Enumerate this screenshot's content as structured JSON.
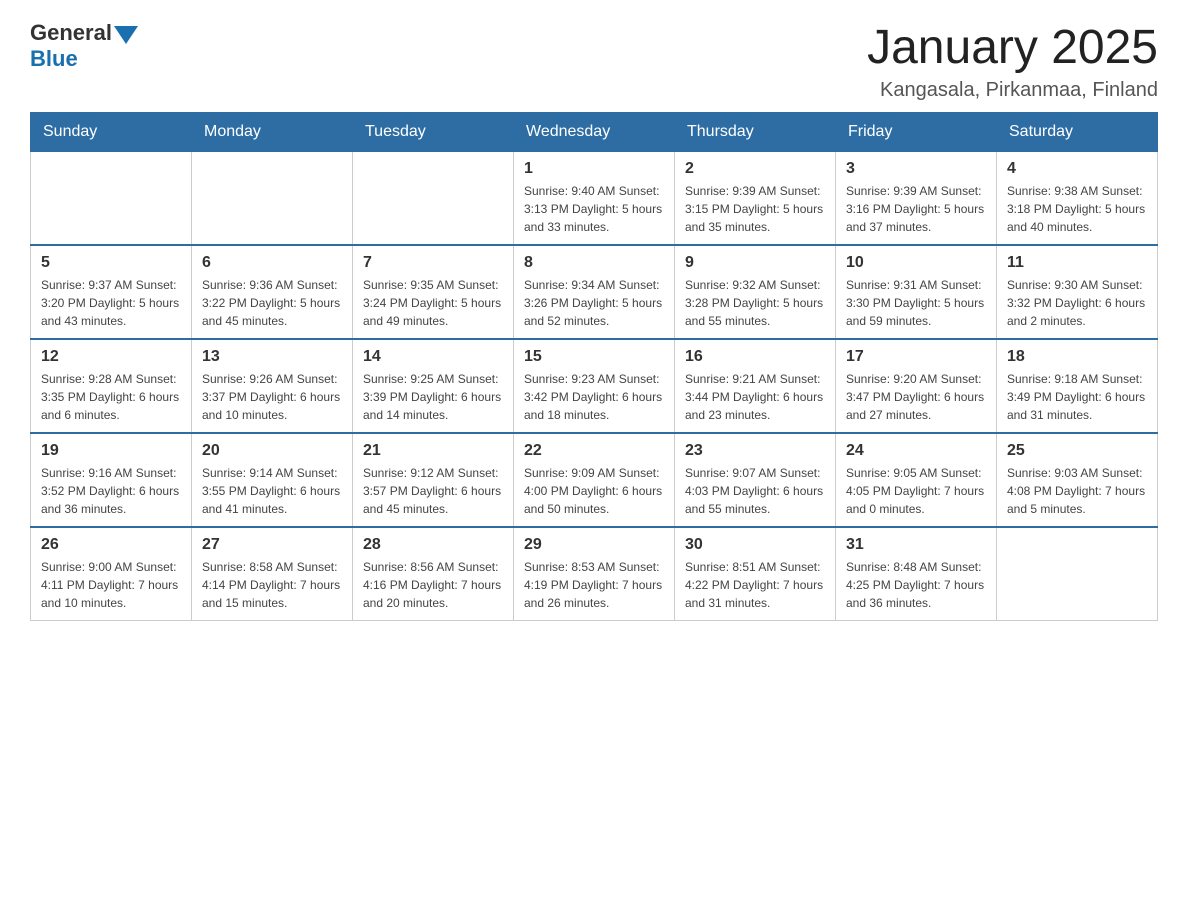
{
  "header": {
    "logo": {
      "general": "General",
      "blue": "Blue"
    },
    "title": "January 2025",
    "subtitle": "Kangasala, Pirkanmaa, Finland"
  },
  "weekdays": [
    "Sunday",
    "Monday",
    "Tuesday",
    "Wednesday",
    "Thursday",
    "Friday",
    "Saturday"
  ],
  "weeks": [
    [
      {
        "day": "",
        "info": ""
      },
      {
        "day": "",
        "info": ""
      },
      {
        "day": "",
        "info": ""
      },
      {
        "day": "1",
        "info": "Sunrise: 9:40 AM\nSunset: 3:13 PM\nDaylight: 5 hours\nand 33 minutes."
      },
      {
        "day": "2",
        "info": "Sunrise: 9:39 AM\nSunset: 3:15 PM\nDaylight: 5 hours\nand 35 minutes."
      },
      {
        "day": "3",
        "info": "Sunrise: 9:39 AM\nSunset: 3:16 PM\nDaylight: 5 hours\nand 37 minutes."
      },
      {
        "day": "4",
        "info": "Sunrise: 9:38 AM\nSunset: 3:18 PM\nDaylight: 5 hours\nand 40 minutes."
      }
    ],
    [
      {
        "day": "5",
        "info": "Sunrise: 9:37 AM\nSunset: 3:20 PM\nDaylight: 5 hours\nand 43 minutes."
      },
      {
        "day": "6",
        "info": "Sunrise: 9:36 AM\nSunset: 3:22 PM\nDaylight: 5 hours\nand 45 minutes."
      },
      {
        "day": "7",
        "info": "Sunrise: 9:35 AM\nSunset: 3:24 PM\nDaylight: 5 hours\nand 49 minutes."
      },
      {
        "day": "8",
        "info": "Sunrise: 9:34 AM\nSunset: 3:26 PM\nDaylight: 5 hours\nand 52 minutes."
      },
      {
        "day": "9",
        "info": "Sunrise: 9:32 AM\nSunset: 3:28 PM\nDaylight: 5 hours\nand 55 minutes."
      },
      {
        "day": "10",
        "info": "Sunrise: 9:31 AM\nSunset: 3:30 PM\nDaylight: 5 hours\nand 59 minutes."
      },
      {
        "day": "11",
        "info": "Sunrise: 9:30 AM\nSunset: 3:32 PM\nDaylight: 6 hours\nand 2 minutes."
      }
    ],
    [
      {
        "day": "12",
        "info": "Sunrise: 9:28 AM\nSunset: 3:35 PM\nDaylight: 6 hours\nand 6 minutes."
      },
      {
        "day": "13",
        "info": "Sunrise: 9:26 AM\nSunset: 3:37 PM\nDaylight: 6 hours\nand 10 minutes."
      },
      {
        "day": "14",
        "info": "Sunrise: 9:25 AM\nSunset: 3:39 PM\nDaylight: 6 hours\nand 14 minutes."
      },
      {
        "day": "15",
        "info": "Sunrise: 9:23 AM\nSunset: 3:42 PM\nDaylight: 6 hours\nand 18 minutes."
      },
      {
        "day": "16",
        "info": "Sunrise: 9:21 AM\nSunset: 3:44 PM\nDaylight: 6 hours\nand 23 minutes."
      },
      {
        "day": "17",
        "info": "Sunrise: 9:20 AM\nSunset: 3:47 PM\nDaylight: 6 hours\nand 27 minutes."
      },
      {
        "day": "18",
        "info": "Sunrise: 9:18 AM\nSunset: 3:49 PM\nDaylight: 6 hours\nand 31 minutes."
      }
    ],
    [
      {
        "day": "19",
        "info": "Sunrise: 9:16 AM\nSunset: 3:52 PM\nDaylight: 6 hours\nand 36 minutes."
      },
      {
        "day": "20",
        "info": "Sunrise: 9:14 AM\nSunset: 3:55 PM\nDaylight: 6 hours\nand 41 minutes."
      },
      {
        "day": "21",
        "info": "Sunrise: 9:12 AM\nSunset: 3:57 PM\nDaylight: 6 hours\nand 45 minutes."
      },
      {
        "day": "22",
        "info": "Sunrise: 9:09 AM\nSunset: 4:00 PM\nDaylight: 6 hours\nand 50 minutes."
      },
      {
        "day": "23",
        "info": "Sunrise: 9:07 AM\nSunset: 4:03 PM\nDaylight: 6 hours\nand 55 minutes."
      },
      {
        "day": "24",
        "info": "Sunrise: 9:05 AM\nSunset: 4:05 PM\nDaylight: 7 hours\nand 0 minutes."
      },
      {
        "day": "25",
        "info": "Sunrise: 9:03 AM\nSunset: 4:08 PM\nDaylight: 7 hours\nand 5 minutes."
      }
    ],
    [
      {
        "day": "26",
        "info": "Sunrise: 9:00 AM\nSunset: 4:11 PM\nDaylight: 7 hours\nand 10 minutes."
      },
      {
        "day": "27",
        "info": "Sunrise: 8:58 AM\nSunset: 4:14 PM\nDaylight: 7 hours\nand 15 minutes."
      },
      {
        "day": "28",
        "info": "Sunrise: 8:56 AM\nSunset: 4:16 PM\nDaylight: 7 hours\nand 20 minutes."
      },
      {
        "day": "29",
        "info": "Sunrise: 8:53 AM\nSunset: 4:19 PM\nDaylight: 7 hours\nand 26 minutes."
      },
      {
        "day": "30",
        "info": "Sunrise: 8:51 AM\nSunset: 4:22 PM\nDaylight: 7 hours\nand 31 minutes."
      },
      {
        "day": "31",
        "info": "Sunrise: 8:48 AM\nSunset: 4:25 PM\nDaylight: 7 hours\nand 36 minutes."
      },
      {
        "day": "",
        "info": ""
      }
    ]
  ]
}
